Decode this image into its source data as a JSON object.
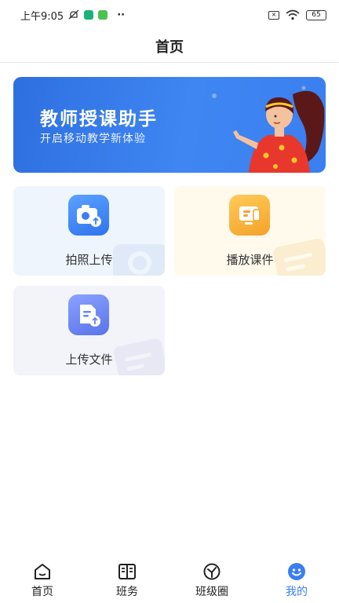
{
  "status_bar": {
    "time": "上午9:05",
    "battery": "65"
  },
  "header": {
    "title": "首页"
  },
  "banner": {
    "title": "教师授课助手",
    "subtitle": "开启移动教学新体验"
  },
  "features": [
    {
      "label": "拍照上传",
      "icon": "camera-upload-icon",
      "color": "#2f74f0"
    },
    {
      "label": "播放课件",
      "icon": "courseware-play-icon",
      "color": "#f4a22a"
    },
    {
      "label": "上传文件",
      "icon": "file-upload-icon",
      "color": "#5a74e8"
    }
  ],
  "tabbar": {
    "items": [
      {
        "label": "首页",
        "icon": "home-icon"
      },
      {
        "label": "班务",
        "icon": "book-icon"
      },
      {
        "label": "班级圈",
        "icon": "circle-icon"
      },
      {
        "label": "我的",
        "icon": "smiley-icon",
        "active": true
      }
    ],
    "active_color": "#3a7ff0"
  }
}
